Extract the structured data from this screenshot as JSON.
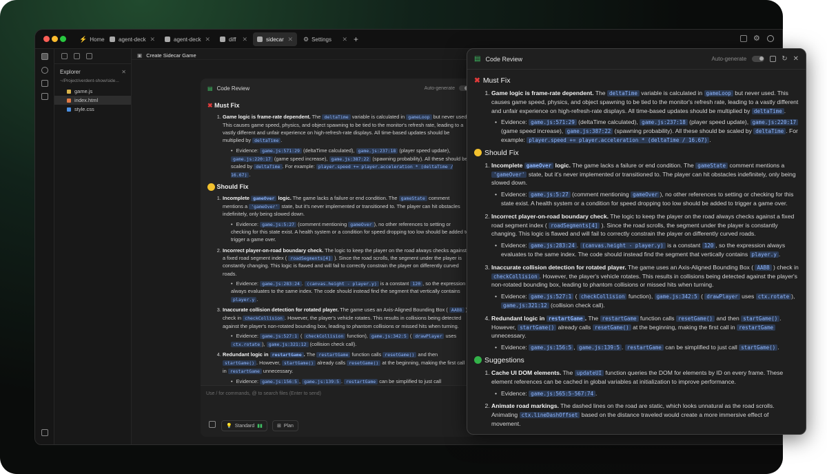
{
  "tabs": [
    {
      "label": "Home",
      "active": false
    },
    {
      "label": "agent-deck",
      "active": false
    },
    {
      "label": "agent-deck",
      "active": false
    },
    {
      "label": "diff",
      "active": false
    },
    {
      "label": "sidecar",
      "active": true
    },
    {
      "label": "Settings",
      "active": false
    }
  ],
  "new_tab": "+",
  "close": "✕",
  "explorer": {
    "title": "Explorer",
    "path": "~/Project/verdent-show/side...",
    "files": [
      "game.js",
      "index.html",
      "style.css"
    ],
    "selected": 1
  },
  "main": {
    "title": "Create Sidecar Game",
    "panel_title": "Code Review",
    "auto_generate": "Auto-generate",
    "composer_placeholder": "Use / for commands, @ to search files (Enter to send)",
    "mode_label": "Standard",
    "plan_label": "Plan"
  },
  "popup": {
    "title": "Code Review",
    "auto_generate": "Auto-generate"
  },
  "review": {
    "must_fix_title": "Must Fix",
    "should_fix_title": "Should Fix",
    "suggestions_title": "Suggestions",
    "evidence_label": "Evidence:",
    "must_fix": [
      {
        "title": "Game logic is frame-rate dependent.",
        "t1": " The ",
        "c1": "deltaTime",
        "t2": " variable is calculated in ",
        "c2": "gameLoop",
        "t3": " but never used. This causes game speed, physics, and object spawning to be tied to the monitor's refresh rate, leading to a vastly different and unfair experience on high-refresh-rate displays. All time-based updates should be multiplied by ",
        "c3": "deltaTime",
        "t4": ".",
        "ev": [
          {
            "c": "game.js:571:29",
            "t": " (deltaTime calculated), "
          },
          {
            "c": "game.js:237:18",
            "t": " (player speed update), "
          },
          {
            "c": "game.js:220:17",
            "t": " (game speed increase), "
          },
          {
            "c": "game.js:387:22",
            "t": " (spawning probability). All these should be scaled by "
          },
          {
            "c": "deltaTime",
            "t": ". For example: "
          },
          {
            "c": "player.speed += player.acceleration * (deltaTime / 16.67)",
            "t": "."
          }
        ]
      }
    ],
    "should_fix": [
      {
        "title1": "Incomplete ",
        "title_code": "gameOver",
        "title2": " logic.",
        "t1": " The game lacks a failure or end condition. The ",
        "c1": "gameState",
        "t2": " comment mentions a ",
        "c2": "'gameOver'",
        "t3": " state, but it's never implemented or transitioned to. The player can hit obstacles indefinitely, only being slowed down.",
        "ev": [
          {
            "c": "game.js:5:27",
            "t": " (comment mentioning "
          },
          {
            "c": "gameOver",
            "t": "), no other references to setting or checking for this state exist. A health system or a condition for speed dropping too low should be added to trigger a game over."
          }
        ]
      },
      {
        "title": "Incorrect player-on-road boundary check.",
        "t1": " The logic to keep the player on the road always checks against a fixed road segment index ( ",
        "c1": "roadSegments[4]",
        "t2": " ). Since the road scrolls, the segment under the player is constantly changing. This logic is flawed and will fail to correctly constrain the player on differently curved roads.",
        "ev": [
          {
            "c": "game.js:283:24",
            "t": ". "
          },
          {
            "c": "(canvas.height - player.y)",
            "t": " is a constant "
          },
          {
            "c": "120",
            "t": ", so the expression always evaluates to the same index. The code should instead find the segment that vertically contains "
          },
          {
            "c": "player.y",
            "t": "."
          }
        ]
      },
      {
        "title": "Inaccurate collision detection for rotated player.",
        "t1": " The game uses an Axis-Aligned Bounding Box ( ",
        "c1": "AABB",
        "t2": " ) check in ",
        "c2": "checkCollision",
        "t3": ". However, the player's vehicle rotates. This results in collisions being detected against the player's non-rotated bounding box, leading to phantom collisions or missed hits when turning.",
        "ev": [
          {
            "c": "game.js:527:1",
            "t": " ( "
          },
          {
            "c": "checkCollision",
            "t": " function), "
          },
          {
            "c": "game.js:342:5",
            "t": " ( "
          },
          {
            "c": "drawPlayer",
            "t": " uses "
          },
          {
            "c": "ctx.rotate",
            "t": "), "
          },
          {
            "c": "game.js:321:12",
            "t": " (collision check call)."
          }
        ]
      },
      {
        "title1": "Redundant logic in ",
        "title_code": "restartGame",
        "title2": ".",
        "t1": " The ",
        "c1": "restartGame",
        "t2": " function calls ",
        "c2": "resetGame()",
        "t3": " and then ",
        "c3": "startGame()",
        "t4": ". However, ",
        "c4": "startGame()",
        "t5": " already calls ",
        "c5": "resetGame()",
        "t6": " at the beginning, making the first call in ",
        "c6": "restartGame",
        "t7": " unnecessary.",
        "ev": [
          {
            "c": "game.js:156:5",
            "t": ", "
          },
          {
            "c": "game.js:139:5",
            "t": ". "
          },
          {
            "c": "restartGame",
            "t": " can be simplified to just call "
          },
          {
            "c": "startGame()",
            "t": "."
          }
        ]
      }
    ],
    "suggestions": [
      {
        "title": "Cache UI DOM elements.",
        "t1": " The ",
        "c1": "updateUI",
        "t2": " function queries the DOM for elements by ID on every frame. These element references can be cached in global variables at initialization to improve performance.",
        "ev": [
          {
            "c": "game.js:565:5-567:74",
            "t": "."
          }
        ]
      },
      {
        "title": "Animate road markings.",
        "t1": " The dashed lines on the road are static, which looks unnatural as the road scrolls. Animating ",
        "c1": "ctx.lineDashOffset",
        "t2": " based on the distance traveled would create a more immersive effect of movement."
      }
    ]
  }
}
